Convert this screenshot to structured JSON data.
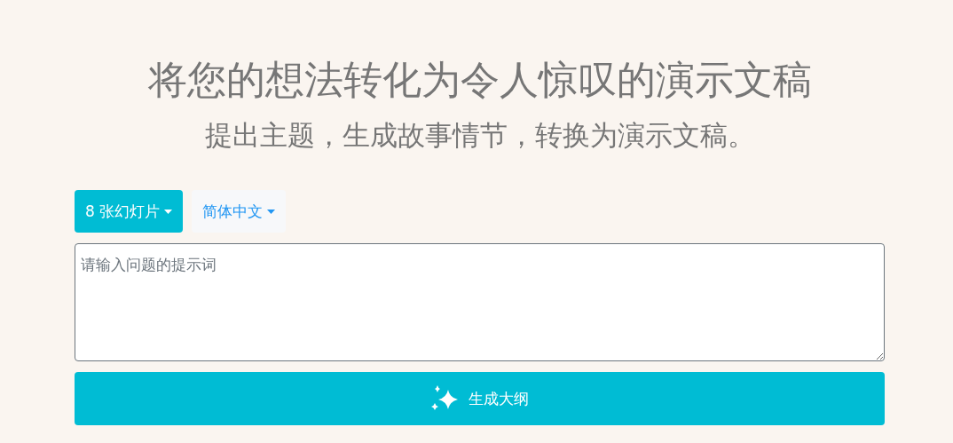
{
  "heading": "将您的想法转化为令人惊叹的演示文稿",
  "subheading": "提出主题，生成故事情节，转换为演示文稿。",
  "dropdowns": [
    {
      "label": "8 张幻灯片",
      "kind": "primary"
    },
    {
      "label": "简体中文",
      "kind": "light"
    }
  ],
  "prompt": {
    "placeholder": "请输入问题的提示词"
  },
  "generate_button": {
    "label": "生成大纲"
  }
}
